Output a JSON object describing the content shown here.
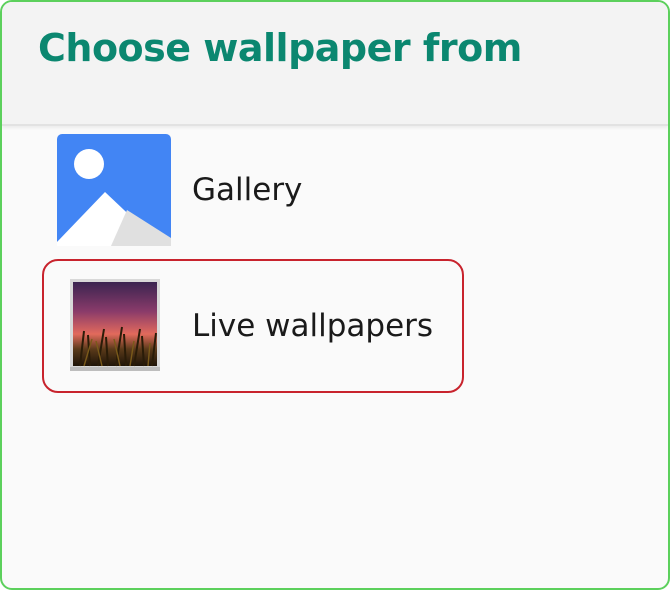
{
  "dialog": {
    "title": "Choose wallpaper from",
    "options": [
      {
        "label": "Gallery",
        "icon": "gallery-icon"
      },
      {
        "label": "Live wallpapers",
        "icon": "live-wallpapers-icon",
        "highlighted": true
      }
    ]
  },
  "colors": {
    "title": "#0b8770",
    "frame_border": "#5cd05c",
    "highlight_border": "#c8232d",
    "gallery_blue": "#4285f4"
  }
}
